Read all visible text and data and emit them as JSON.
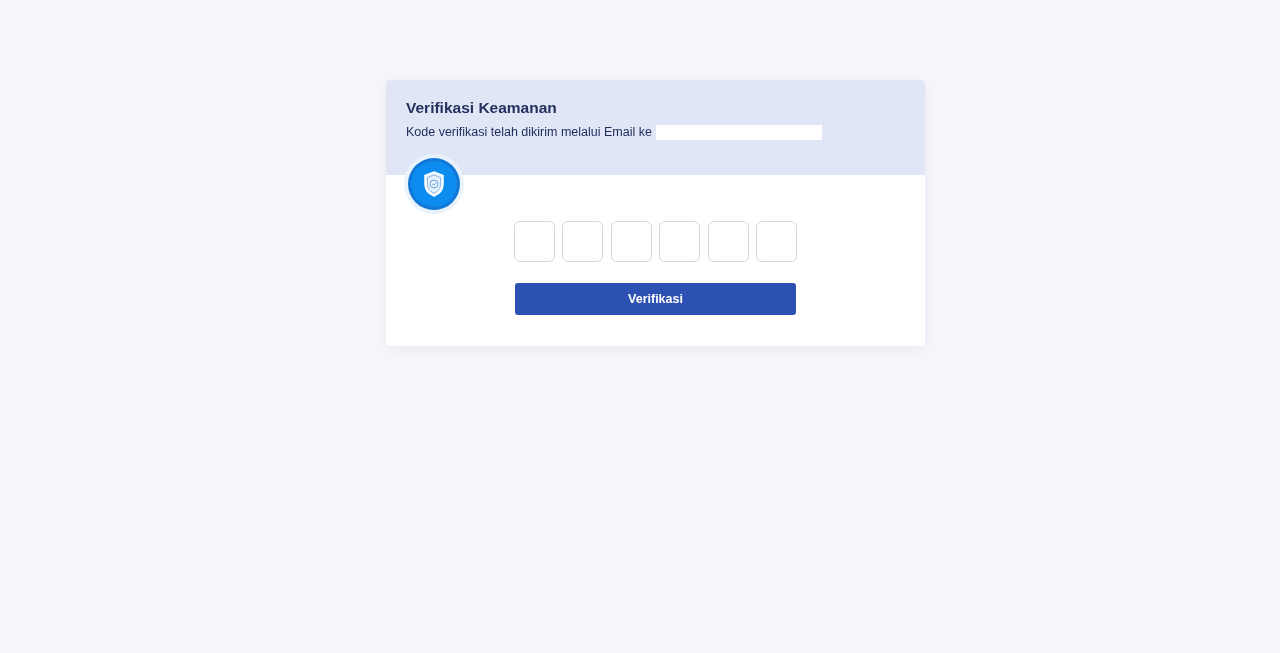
{
  "card": {
    "title": "Verifikasi Keamanan",
    "message": "Kode verifikasi telah dikirim melalui Email ke",
    "recipient_redacted": true
  },
  "code_inputs": [
    {
      "focused": false
    },
    {
      "focused": false
    },
    {
      "focused": false
    },
    {
      "focused": false
    },
    {
      "focused": false
    },
    {
      "focused": false
    }
  ],
  "submit_button": {
    "label": "Verifikasi"
  }
}
